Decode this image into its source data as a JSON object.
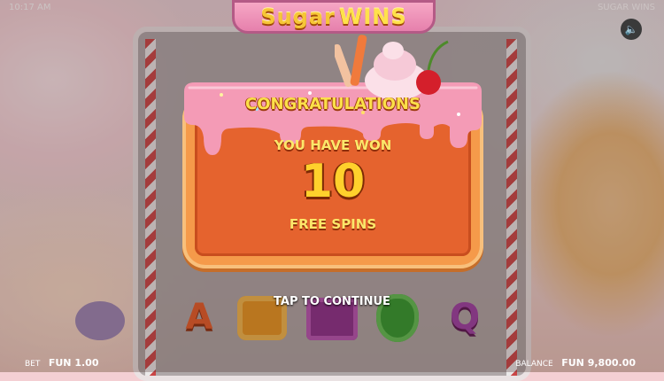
{
  "status_bar": {
    "time": "10:17 AM",
    "game_name": "SUGAR WINS"
  },
  "logo": {
    "part1": "Sugar",
    "part2": "WINS"
  },
  "sound_icon": "speaker-icon",
  "reels": {
    "visible_symbols": [
      "A",
      "orange-candy",
      "purple-candy",
      "green-jelly",
      "Q"
    ]
  },
  "popup": {
    "heading": "CONGRATULATIONS",
    "line1": "YOU HAVE WON",
    "count": "10",
    "line2": "FREE SPINS"
  },
  "prompt": "TAP TO CONTINUE",
  "footer": {
    "bet_label": "BET",
    "bet_value": "FUN 1.00",
    "balance_label": "BALANCE",
    "balance_value": "FUN 9,800.00"
  },
  "colors": {
    "icing": "#f49bb6",
    "biscuit": "#f59a4a",
    "panel": "#e5632e",
    "gold_text": "#ffd12c"
  }
}
